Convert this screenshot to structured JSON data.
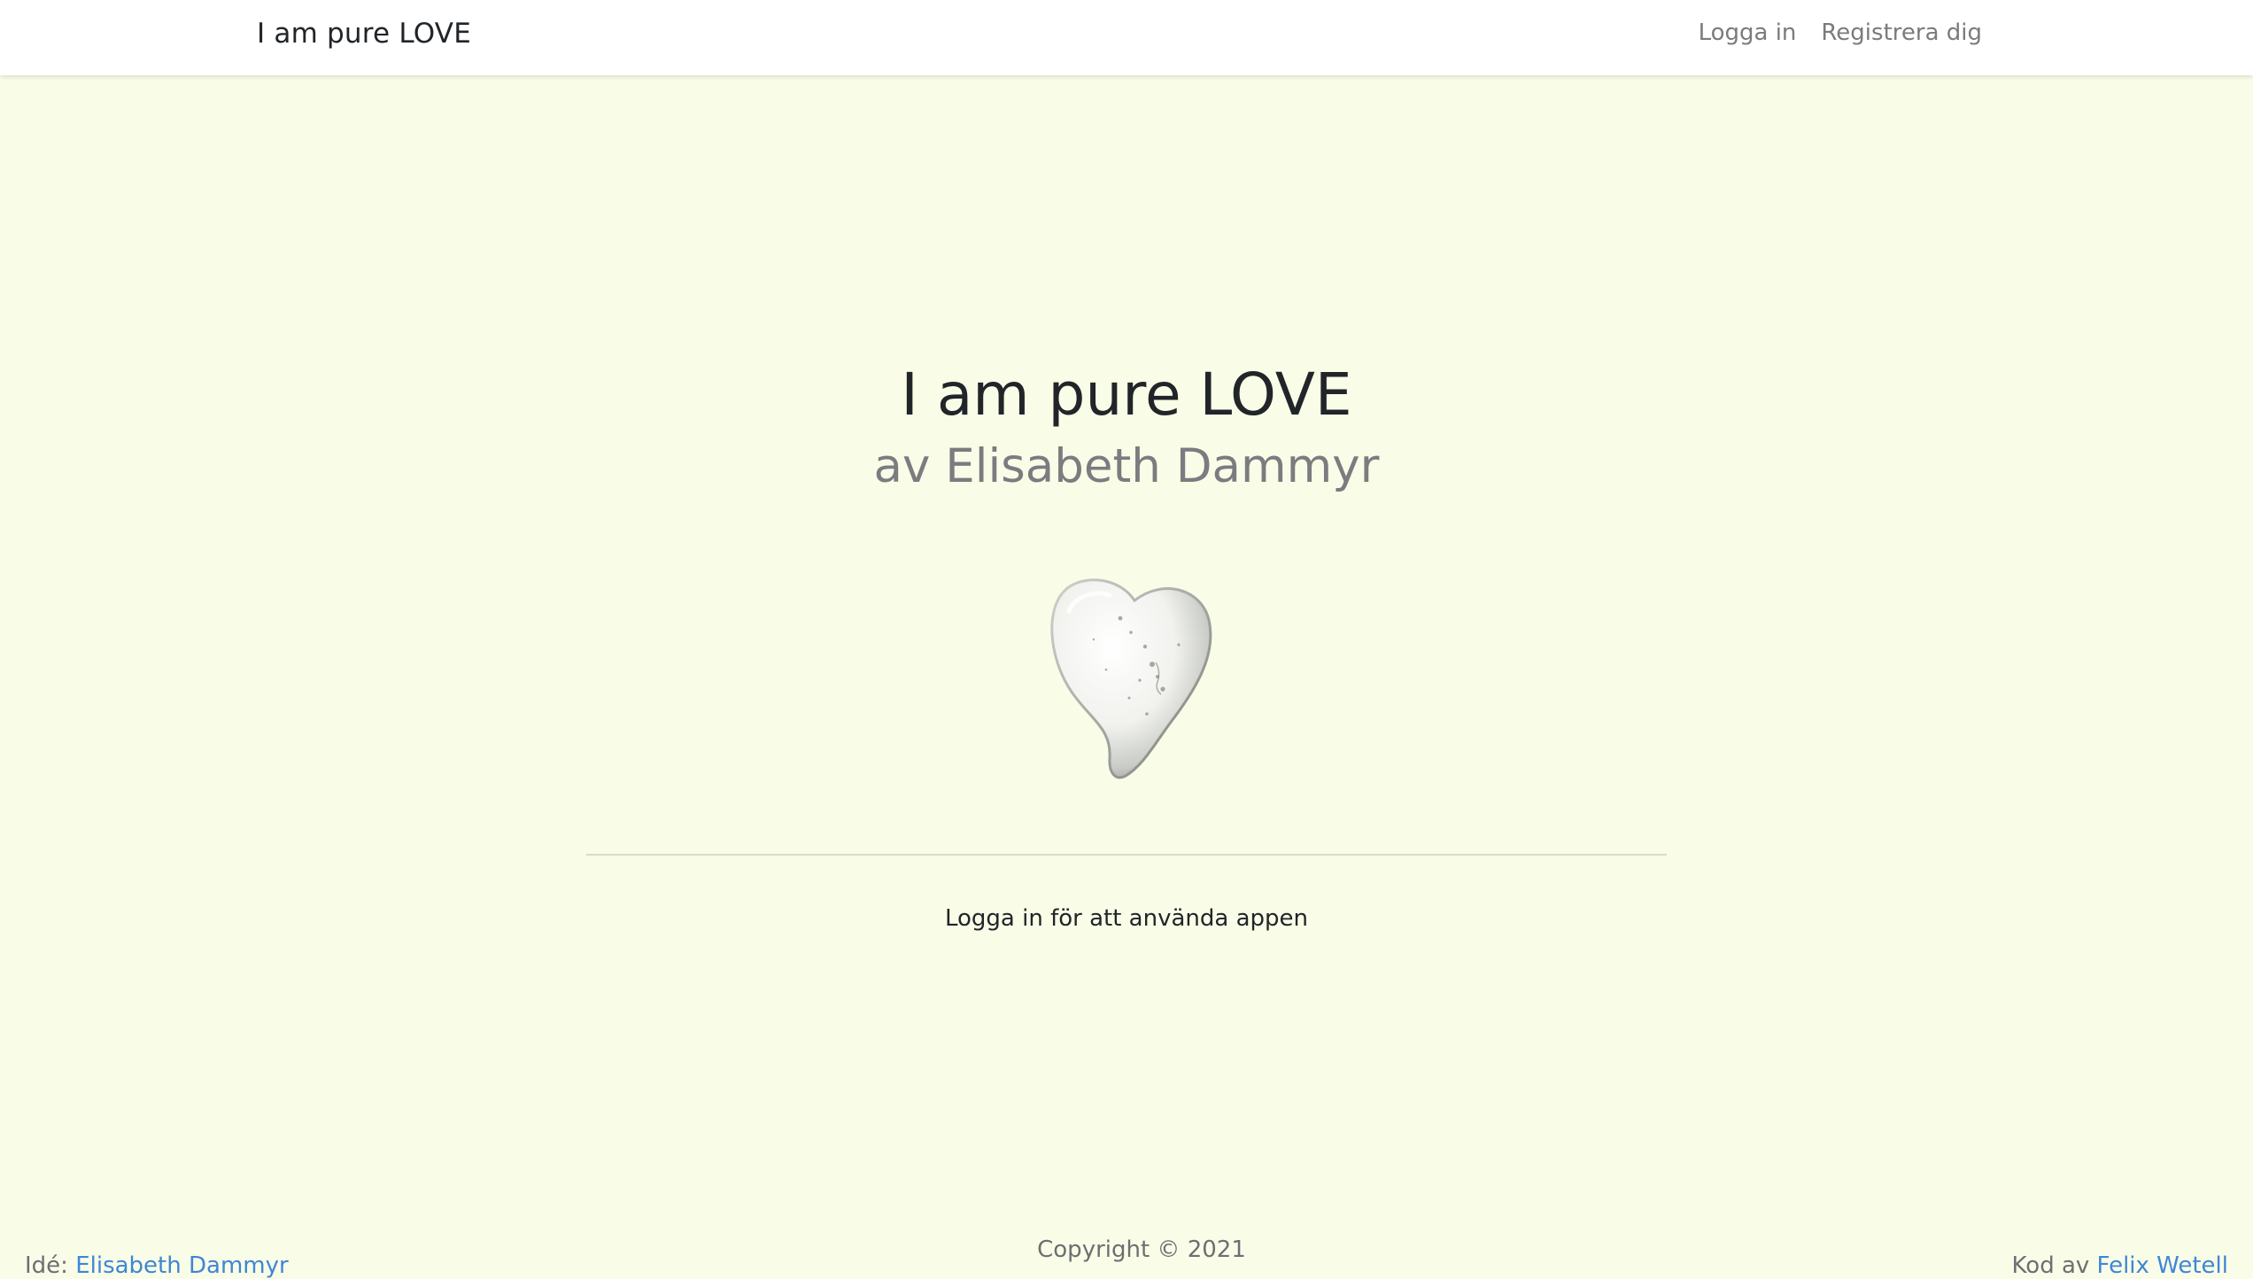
{
  "navbar": {
    "brand": "I am pure LOVE",
    "links": [
      {
        "label": "Logga in"
      },
      {
        "label": "Registrera dig"
      }
    ]
  },
  "hero": {
    "title": "I am pure LOVE",
    "subtitle": "av Elisabeth Dammyr",
    "image": "white-stone-heart"
  },
  "main": {
    "login_note": "Logga in för att använda appen"
  },
  "footer": {
    "idea_label": "Idé:",
    "idea_author": "Elisabeth Dammyr",
    "copyright": "Copyright © 2021",
    "code_label": "Kod av",
    "code_author": "Felix Wetell"
  },
  "colors": {
    "background": "#f9fde7",
    "navbar": "#ffffff",
    "link": "#3f86d6",
    "muted": "#7a7c80"
  }
}
